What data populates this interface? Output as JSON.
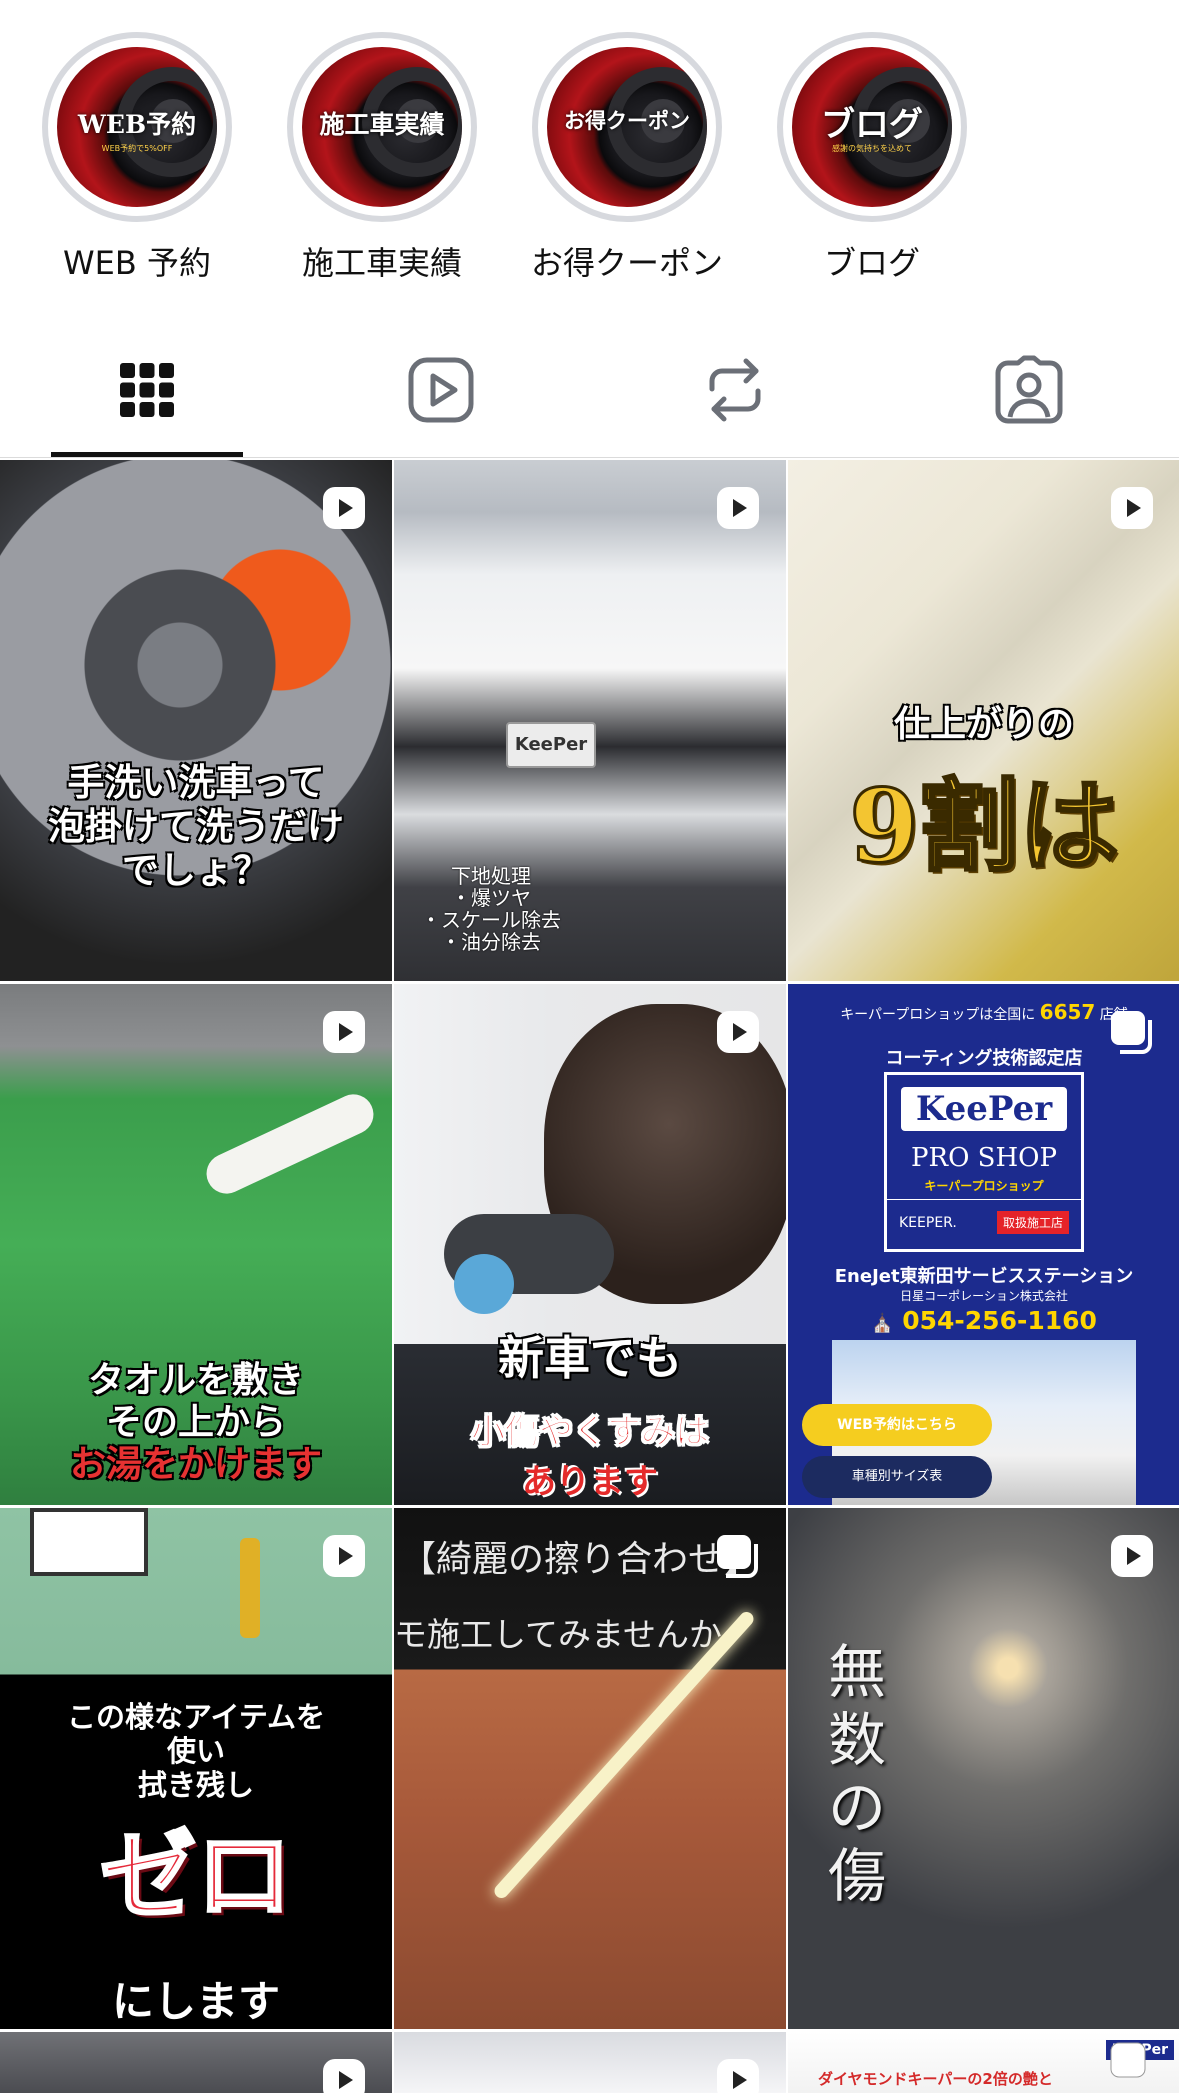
{
  "highlights": [
    {
      "label": "WEB 予約",
      "cover_text": "WEB予約",
      "cover_sub": "WEB予約で5%OFF"
    },
    {
      "label": "施工車実績",
      "cover_text": "施工車実績",
      "cover_sub": ""
    },
    {
      "label": "お得クーポン",
      "cover_text": "お得クーポン",
      "cover_sub": ""
    },
    {
      "label": "ブログ",
      "cover_text": "ブログ",
      "cover_sub": "感謝の気持ちを込めて"
    }
  ],
  "tabs": [
    {
      "name": "posts",
      "icon": "grid-icon",
      "active": true
    },
    {
      "name": "reels",
      "icon": "reels-play-icon",
      "active": false
    },
    {
      "name": "reposts",
      "icon": "repost-icon",
      "active": false
    },
    {
      "name": "tagged",
      "icon": "tagged-person-icon",
      "active": false
    }
  ],
  "posts": [
    {
      "type": "reel",
      "caption_lines": [
        "手洗い洗車って",
        "泡掛けて洗うだけ",
        "でしょ？"
      ]
    },
    {
      "type": "reel",
      "plate": "KeePer",
      "caption_lines": [
        "下地処理",
        "・爆ツヤ",
        "・スケール除去",
        "・油分除去"
      ]
    },
    {
      "type": "reel",
      "caption_top": "仕上がりの",
      "caption_big": "9割は"
    },
    {
      "type": "reel",
      "caption_lines": [
        "タオルを敷き",
        "その上から",
        "お湯をかけます"
      ]
    },
    {
      "type": "reel",
      "caption_top": "新車でも",
      "caption_red": "小傷やくすみは",
      "caption_cut": "あります"
    },
    {
      "type": "carousel",
      "top_line_prefix": "キーパープロショップは全国に",
      "top_line_count": "6657",
      "top_line_suffix": "店舗",
      "badge_title": "コーティング技術認定店",
      "logo": "KeePer",
      "pro_shop": "PRO SHOP",
      "pro_shop_kana": "キーパープロショップ",
      "keeper_brand": "KEEPER.",
      "dealer_tag": "取扱施工店",
      "station": "EneJet東新田サービスステーション",
      "company": "日星コーポレーション株式会社",
      "phone": "054-256-1160",
      "cta_primary": "WEB予約はこちら",
      "cta_secondary": "車種別サイズ表"
    },
    {
      "type": "reel",
      "caption_lines": [
        "この様なアイテムを",
        "使い",
        "拭き残し"
      ],
      "caption_big": "ゼロ",
      "caption_bottom": "にします"
    },
    {
      "type": "carousel",
      "caption_lines": [
        "【綺麗の擦り合わせ】",
        "モ施工してみませんか"
      ]
    },
    {
      "type": "reel",
      "caption_vertical": "無数の傷"
    },
    {
      "type": "reel",
      "caption": ""
    },
    {
      "type": "reel",
      "caption": ""
    },
    {
      "type": "carousel",
      "caption": "ダイヤモンドキーパーの2倍の艶と",
      "logo": "KeePer"
    }
  ]
}
